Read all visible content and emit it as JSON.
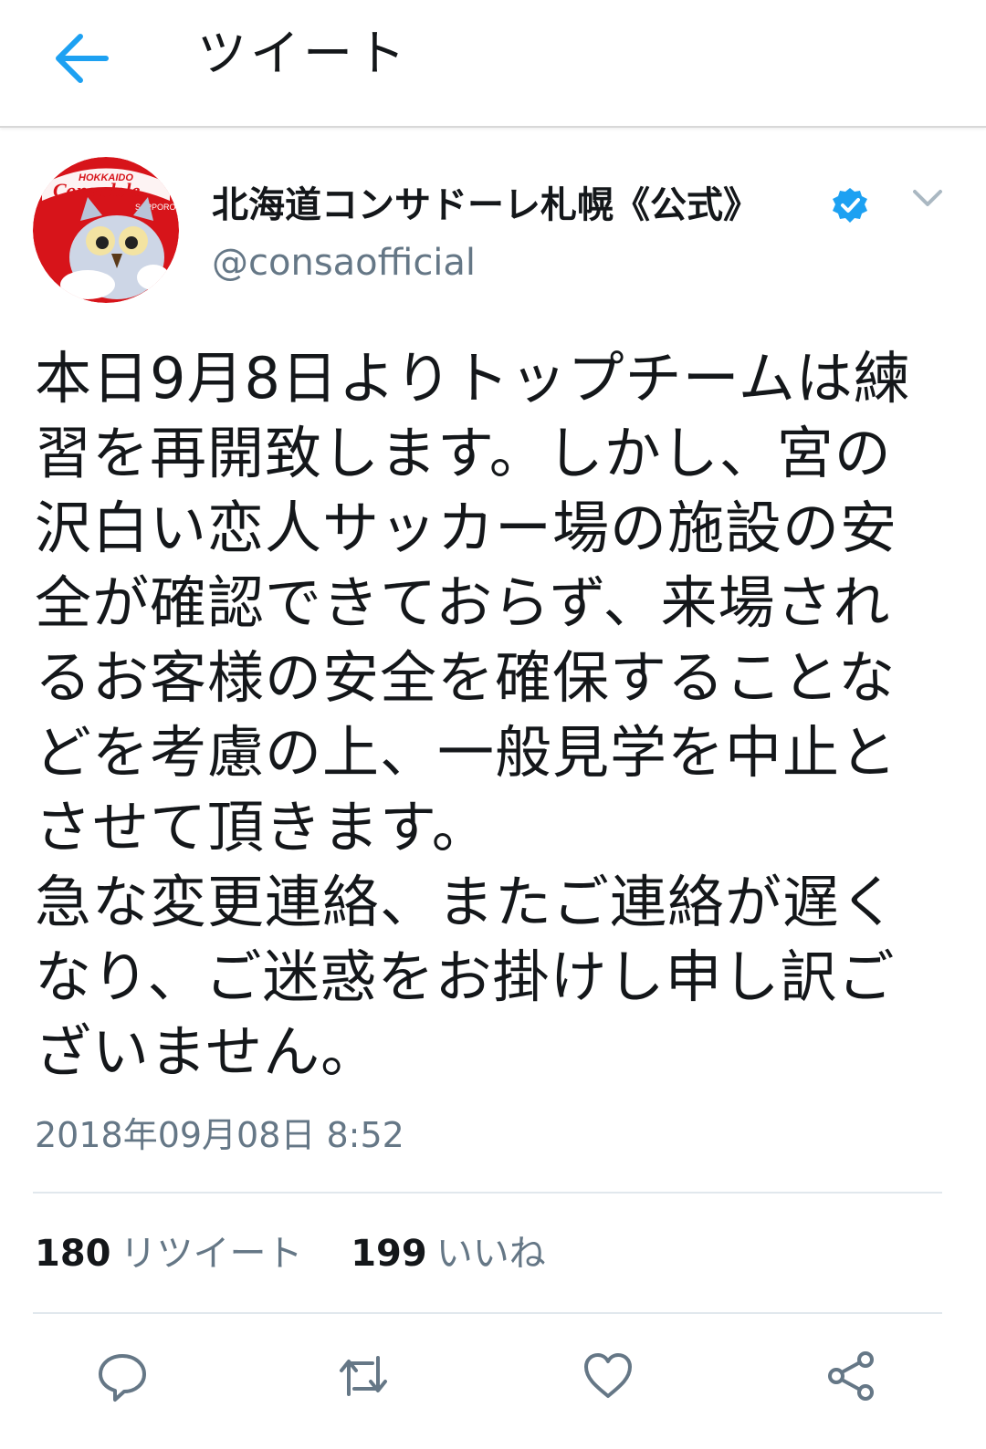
{
  "header": {
    "title": "ツイート",
    "back_icon": "arrow-left-icon",
    "accent": "#1da1f2"
  },
  "author": {
    "display_name": "北海道コンサドーレ札幌《公式》",
    "handle": "@consaofficial",
    "verified": true,
    "avatar_logo_text": "Consadole",
    "avatar_top_text": "HOKKAIDO",
    "avatar_side_text": "SAPPORO",
    "badge_color": "#1da1f2"
  },
  "tweet": {
    "lines": [
      "本日9月8日よりトップチームは練",
      "習を再開致します。しかし、宮の",
      "沢白い恋人サッカー場の施設の安",
      "全が確認できておらず、来場され",
      "るお客様の安全を確保することな",
      "どを考慮の上、一般見学を中止と",
      "させて頂きます。",
      "急な変更連絡、またご連絡が遅く",
      "なり、ご迷惑をお掛けし申し訳ご",
      "ざいません。"
    ],
    "timestamp": "2018年09月08日 8:52"
  },
  "stats": {
    "retweets": {
      "count": "180",
      "label": "リツイート"
    },
    "likes": {
      "count": "199",
      "label": "いいね"
    }
  },
  "actions": [
    "reply-icon",
    "retweet-icon",
    "like-icon",
    "share-icon"
  ],
  "colors": {
    "text": "#14171a",
    "secondary": "#657786",
    "divider": "#e1e8ed",
    "icon": "#657786"
  }
}
